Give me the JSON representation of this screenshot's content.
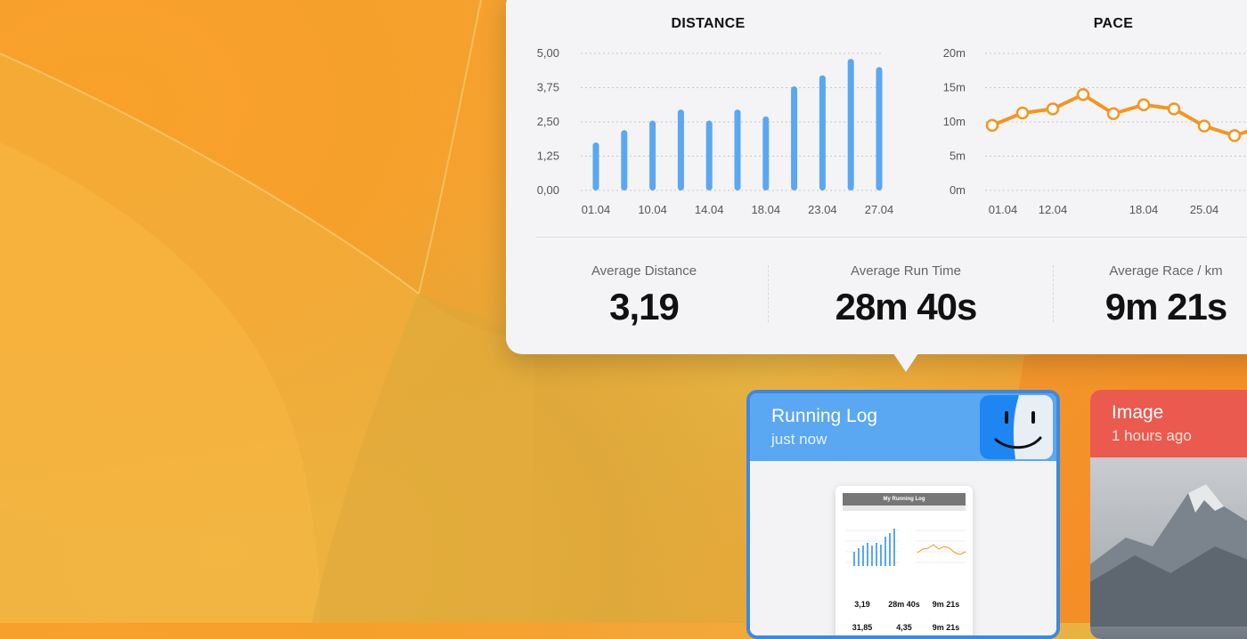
{
  "popover": {
    "distance_chart": {
      "title": "DISTANCE",
      "y_ticks": [
        "5,00",
        "3,75",
        "2,50",
        "1,25",
        "0,00"
      ],
      "x_ticks": [
        "01.04",
        "10.04",
        "14.04",
        "18.04",
        "23.04",
        "27.04"
      ]
    },
    "pace_chart": {
      "title": "PACE",
      "y_ticks": [
        "20m",
        "15m",
        "10m",
        "5m",
        "0m"
      ],
      "x_ticks": [
        "01.04",
        "12.04",
        "18.04",
        "25.04"
      ]
    },
    "stats": [
      {
        "label": "Average Distance",
        "value": "3,19"
      },
      {
        "label": "Average Run Time",
        "value": "28m 40s"
      },
      {
        "label": "Average Race / km",
        "value": "9m 21s"
      }
    ]
  },
  "cards": {
    "running_log": {
      "title": "Running Log",
      "subtitle": "just now",
      "preview": {
        "title": "My Running Log",
        "stats_row1": [
          "3,19",
          "28m 40s",
          "9m 21s"
        ],
        "stats_row2": [
          "31,85",
          "4,35",
          "9m 21s"
        ]
      }
    },
    "image": {
      "title": "Image",
      "subtitle": "1 hours ago"
    }
  },
  "chart_data": [
    {
      "type": "bar",
      "title": "DISTANCE",
      "categories": [
        "01.04",
        "",
        "10.04",
        "",
        "14.04",
        "",
        "18.04",
        "",
        "23.04",
        "",
        "27.04"
      ],
      "values": [
        1.75,
        2.2,
        2.55,
        2.95,
        2.55,
        2.95,
        2.7,
        3.8,
        4.2,
        4.8,
        4.5
      ],
      "ylim": [
        0,
        5
      ],
      "y_ticks": [
        "0,00",
        "1,25",
        "2,50",
        "3,75",
        "5,00"
      ],
      "grid": true,
      "color": "#5aa7f2"
    },
    {
      "type": "line",
      "title": "PACE",
      "x": [
        "01.04",
        "",
        "12.04",
        "",
        "",
        "18.04",
        "",
        "25.04",
        ""
      ],
      "values": [
        9.5,
        11.3,
        11.9,
        14,
        11.2,
        12.5,
        11.9,
        9.4,
        8
      ],
      "ylim": [
        0,
        20
      ],
      "y_ticks": [
        "0m",
        "5m",
        "10m",
        "15m",
        "20m"
      ],
      "grid": true,
      "color": "#f5951e"
    }
  ]
}
